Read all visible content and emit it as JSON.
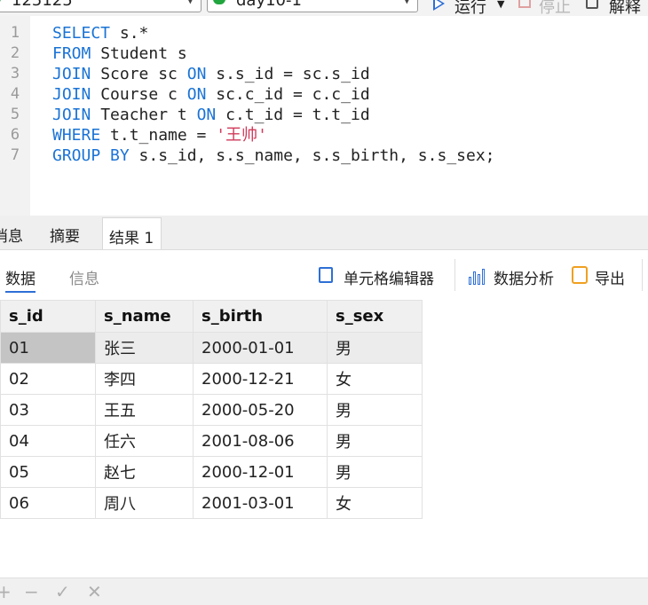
{
  "toolbar": {
    "connection": "125125",
    "database": "day10-1",
    "run_label": "运行",
    "stop_label": "停止",
    "explain_label": "解释"
  },
  "editor": {
    "lines": [
      {
        "num": "1",
        "tokens": [
          {
            "t": "SELECT",
            "c": "kw"
          },
          {
            "t": " s.*",
            "c": ""
          }
        ]
      },
      {
        "num": "2",
        "tokens": [
          {
            "t": "FROM",
            "c": "kw"
          },
          {
            "t": " Student s",
            "c": ""
          }
        ]
      },
      {
        "num": "3",
        "tokens": [
          {
            "t": "JOIN",
            "c": "kw"
          },
          {
            "t": " Score sc ",
            "c": ""
          },
          {
            "t": "ON",
            "c": "kw"
          },
          {
            "t": " s.s_id = sc.s_id",
            "c": ""
          }
        ]
      },
      {
        "num": "4",
        "tokens": [
          {
            "t": "JOIN",
            "c": "kw"
          },
          {
            "t": " Course c ",
            "c": ""
          },
          {
            "t": "ON",
            "c": "kw"
          },
          {
            "t": " sc.c_id = c.c_id",
            "c": ""
          }
        ]
      },
      {
        "num": "5",
        "tokens": [
          {
            "t": "JOIN",
            "c": "kw"
          },
          {
            "t": " Teacher t ",
            "c": ""
          },
          {
            "t": "ON",
            "c": "kw"
          },
          {
            "t": " c.t_id = t.t_id",
            "c": ""
          }
        ]
      },
      {
        "num": "6",
        "tokens": [
          {
            "t": "WHERE",
            "c": "kw"
          },
          {
            "t": " t.t_name = ",
            "c": ""
          },
          {
            "t": "'王帅'",
            "c": "str"
          }
        ]
      },
      {
        "num": "7",
        "tokens": [
          {
            "t": "GROUP BY",
            "c": "kw"
          },
          {
            "t": " s.s_id, s.s_name, s.s_birth, s.s_sex;",
            "c": ""
          }
        ]
      }
    ]
  },
  "result_tabs": {
    "messages": "消息",
    "summary": "摘要",
    "result1": "结果 1"
  },
  "subbar": {
    "data_tab": "数据",
    "info_tab": "信息",
    "cell_editor": "单元格编辑器",
    "data_analysis": "数据分析",
    "export": "导出"
  },
  "grid": {
    "columns": [
      "s_id",
      "s_name",
      "s_birth",
      "s_sex"
    ],
    "rows": [
      [
        "01",
        "张三",
        "2000-01-01",
        "男"
      ],
      [
        "02",
        "李四",
        "2000-12-21",
        "女"
      ],
      [
        "03",
        "王五",
        "2000-05-20",
        "男"
      ],
      [
        "04",
        "任六",
        "2001-08-06",
        "男"
      ],
      [
        "05",
        "赵七",
        "2000-12-01",
        "男"
      ],
      [
        "06",
        "周八",
        "2001-03-01",
        "女"
      ]
    ],
    "selected_row": 0
  },
  "bottombar": {
    "add": "+",
    "remove": "−",
    "apply": "✓",
    "discard": "✕"
  }
}
